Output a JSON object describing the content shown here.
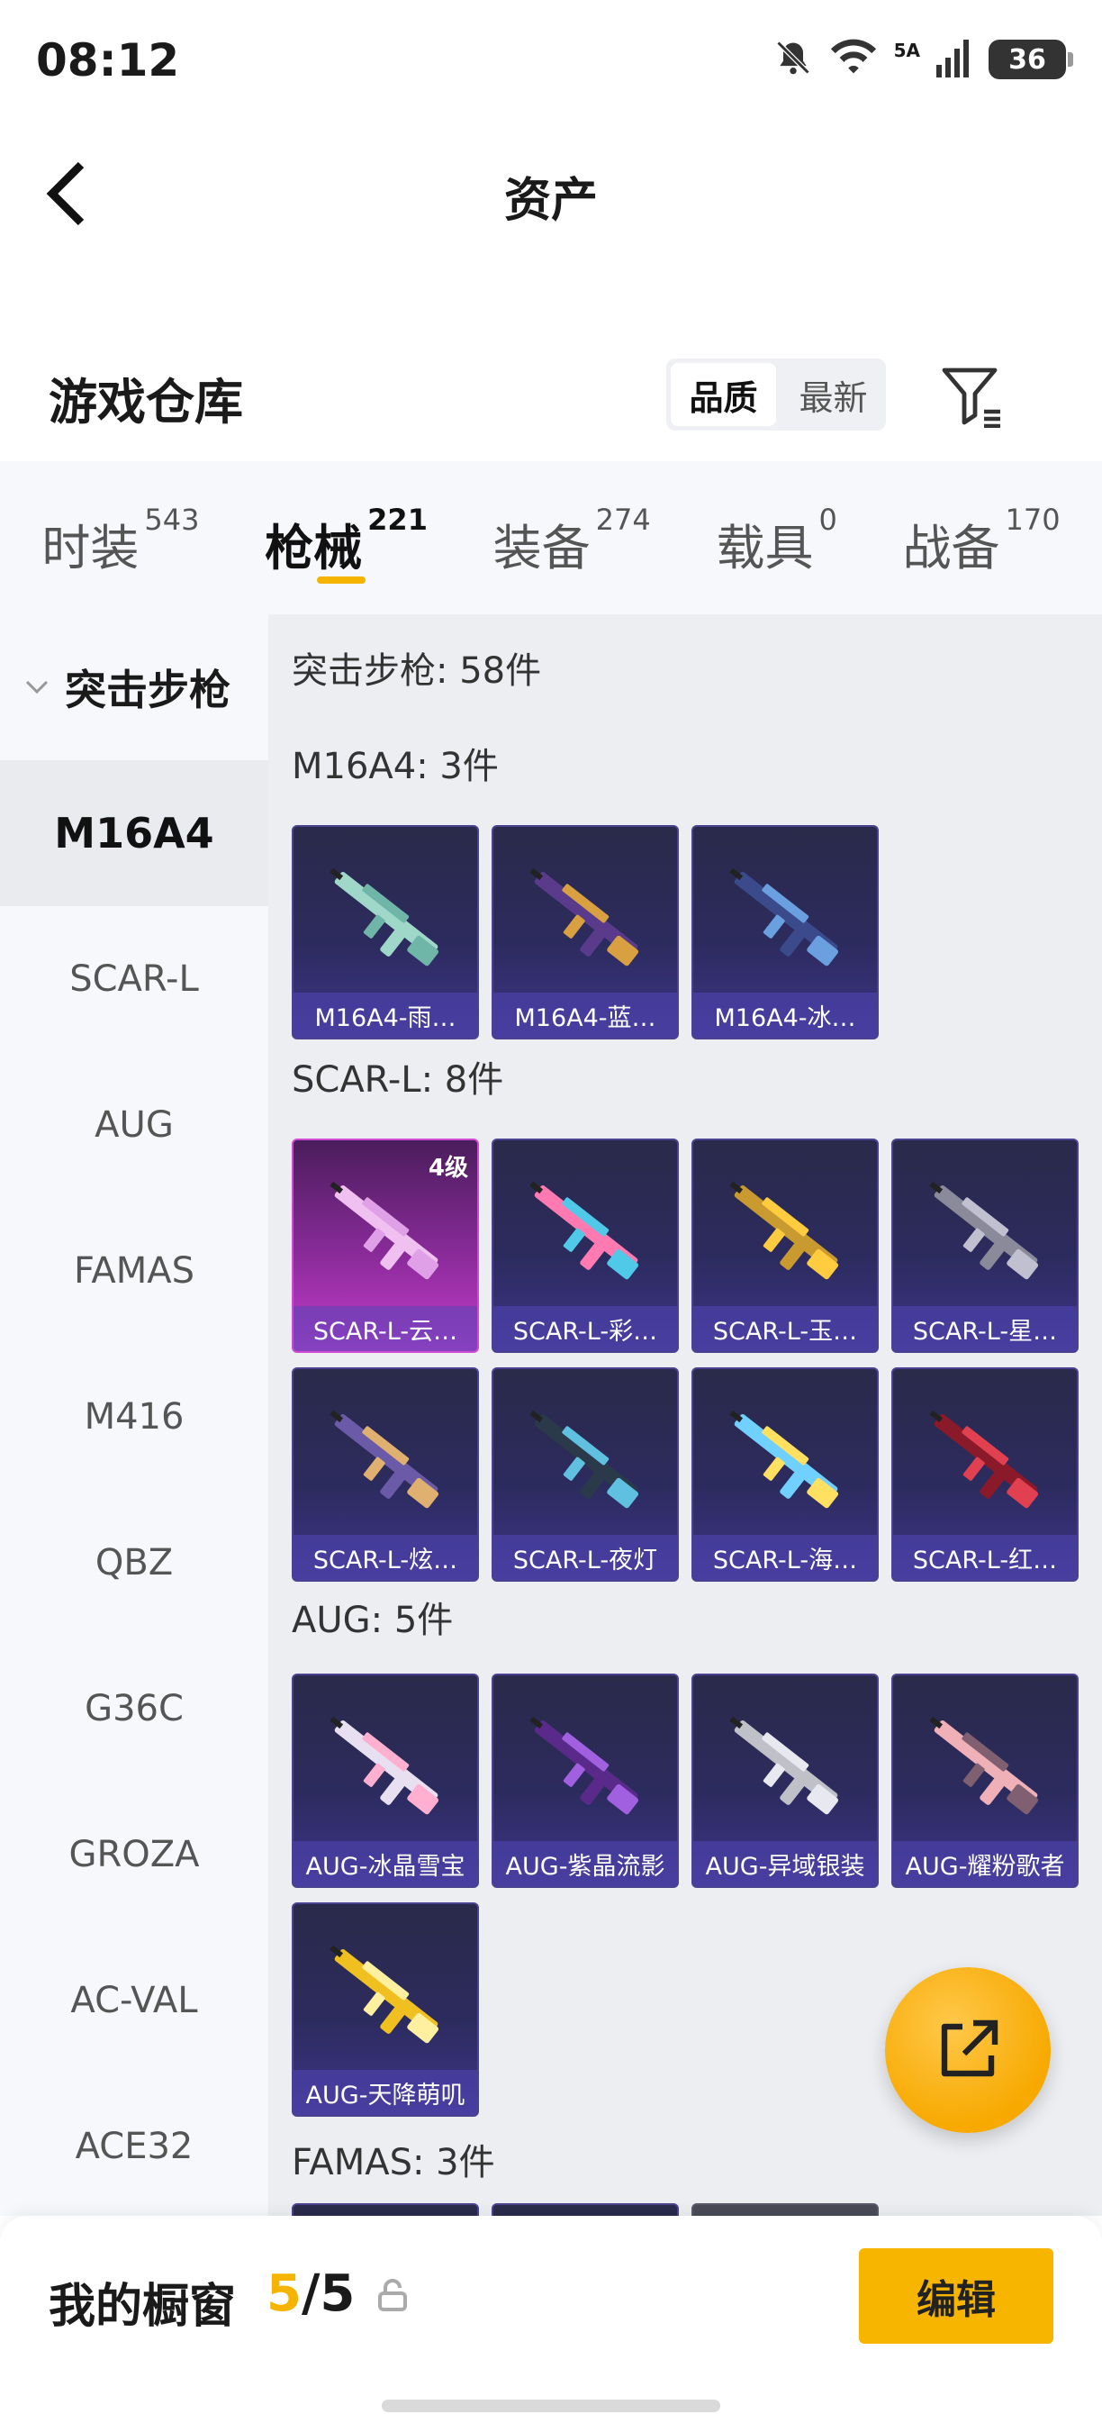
{
  "status": {
    "time": "08:12",
    "network": "5A",
    "battery": "36"
  },
  "header": {
    "title": "资产"
  },
  "warehouse": {
    "title": "游戏仓库",
    "sort_options": [
      {
        "label": "品质",
        "active": true
      },
      {
        "label": "最新",
        "active": false
      }
    ]
  },
  "tabs": [
    {
      "label": "时装",
      "count": "543"
    },
    {
      "label": "枪械",
      "count": "221"
    },
    {
      "label": "装备",
      "count": "274"
    },
    {
      "label": "载具",
      "count": "0"
    },
    {
      "label": "战备",
      "count": "170"
    }
  ],
  "active_tab": 1,
  "sidebar": {
    "group": "突击步枪",
    "items": [
      "M16A4",
      "SCAR-L",
      "AUG",
      "FAMAS",
      "M416",
      "QBZ",
      "G36C",
      "GROZA",
      "AC-VAL",
      "ACE32"
    ],
    "active_index": 0
  },
  "content": {
    "category_title": "突击步枪: 58件",
    "sections": [
      {
        "title": "M16A4: 3件",
        "items": [
          {
            "label": "M16A4-雨…"
          },
          {
            "label": "M16A4-蓝…"
          },
          {
            "label": "M16A4-冰…"
          }
        ]
      },
      {
        "title": "SCAR-L: 8件",
        "items": [
          {
            "label": "SCAR-L-云…",
            "level": "4级"
          },
          {
            "label": "SCAR-L-彩…"
          },
          {
            "label": "SCAR-L-玉…"
          },
          {
            "label": "SCAR-L-星…"
          },
          {
            "label": "SCAR-L-炫…"
          },
          {
            "label": "SCAR-L-夜灯"
          },
          {
            "label": "SCAR-L-海…"
          },
          {
            "label": "SCAR-L-红…"
          }
        ]
      },
      {
        "title": "AUG: 5件",
        "items": [
          {
            "label": "AUG-冰晶雪宝"
          },
          {
            "label": "AUG-紫晶流影"
          },
          {
            "label": "AUG-异域银装"
          },
          {
            "label": "AUG-耀粉歌者"
          },
          {
            "label": "AUG-天降萌叽"
          }
        ]
      },
      {
        "title": "FAMAS: 3件",
        "items": []
      }
    ]
  },
  "colors": {
    "accent": "#f5b400"
  },
  "bottom": {
    "label": "我的橱窗",
    "current": "5",
    "total": "5",
    "edit_label": "编辑"
  }
}
